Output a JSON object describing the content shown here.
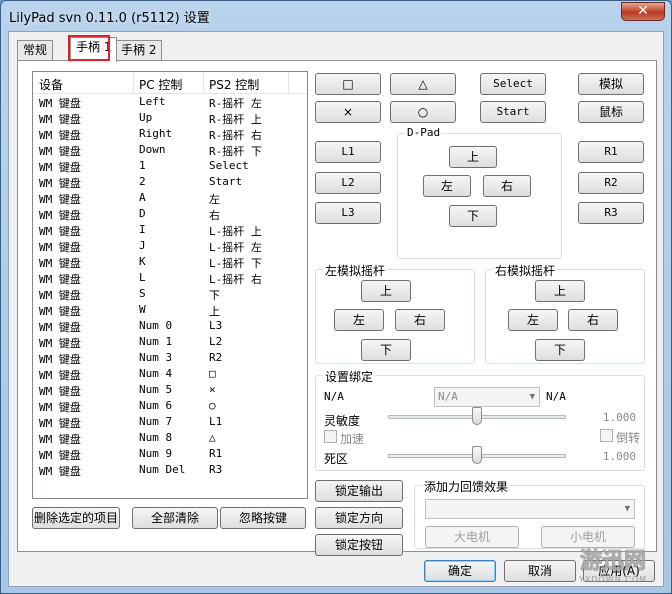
{
  "window": {
    "title": "LilyPad svn 0.11.0 (r5112) 设置",
    "close_glyph": "✕"
  },
  "tabs": [
    {
      "label": "常规"
    },
    {
      "label": "手柄 1"
    },
    {
      "label": "手柄 2"
    }
  ],
  "binding_list": {
    "columns": [
      "设备",
      "PC 控制",
      "PS2 控制"
    ],
    "rows": [
      {
        "device": "WM 键盘",
        "pc": "Left",
        "ps2": "R-摇杆 左"
      },
      {
        "device": "WM 键盘",
        "pc": "Up",
        "ps2": "R-摇杆 上"
      },
      {
        "device": "WM 键盘",
        "pc": "Right",
        "ps2": "R-摇杆 右"
      },
      {
        "device": "WM 键盘",
        "pc": "Down",
        "ps2": "R-摇杆 下"
      },
      {
        "device": "WM 键盘",
        "pc": "1",
        "ps2": "Select"
      },
      {
        "device": "WM 键盘",
        "pc": "2",
        "ps2": "Start"
      },
      {
        "device": "WM 键盘",
        "pc": "A",
        "ps2": "左"
      },
      {
        "device": "WM 键盘",
        "pc": "D",
        "ps2": "右"
      },
      {
        "device": "WM 键盘",
        "pc": "I",
        "ps2": "L-摇杆 上"
      },
      {
        "device": "WM 键盘",
        "pc": "J",
        "ps2": "L-摇杆 左"
      },
      {
        "device": "WM 键盘",
        "pc": "K",
        "ps2": "L-摇杆 下"
      },
      {
        "device": "WM 键盘",
        "pc": "L",
        "ps2": "L-摇杆 右"
      },
      {
        "device": "WM 键盘",
        "pc": "S",
        "ps2": "下"
      },
      {
        "device": "WM 键盘",
        "pc": "W",
        "ps2": "上"
      },
      {
        "device": "WM 键盘",
        "pc": "Num 0",
        "ps2": "L3"
      },
      {
        "device": "WM 键盘",
        "pc": "Num 1",
        "ps2": "L2"
      },
      {
        "device": "WM 键盘",
        "pc": "Num 3",
        "ps2": "R2"
      },
      {
        "device": "WM 键盘",
        "pc": "Num 4",
        "ps2": "□"
      },
      {
        "device": "WM 键盘",
        "pc": "Num 5",
        "ps2": "×"
      },
      {
        "device": "WM 键盘",
        "pc": "Num 6",
        "ps2": "○"
      },
      {
        "device": "WM 键盘",
        "pc": "Num 7",
        "ps2": "L1"
      },
      {
        "device": "WM 键盘",
        "pc": "Num 8",
        "ps2": "△"
      },
      {
        "device": "WM 键盘",
        "pc": "Num 9",
        "ps2": "R1"
      },
      {
        "device": "WM 键盘",
        "pc": "Num Del",
        "ps2": "R3"
      }
    ]
  },
  "list_actions": {
    "delete_selected": "删除选定的项目",
    "clear_all": "全部清除",
    "ignore_key": "忽略按键"
  },
  "face_buttons": {
    "square": "□",
    "triangle": "△",
    "select": "Select",
    "analog": "模拟",
    "cross": "×",
    "circle": "○",
    "start": "Start",
    "mouse": "鼠标"
  },
  "shoulder_buttons": {
    "l1": "L1",
    "l2": "L2",
    "l3": "L3",
    "r1": "R1",
    "r2": "R2",
    "r3": "R3"
  },
  "dpad": {
    "title": "D-Pad",
    "up": "上",
    "left": "左",
    "right": "右",
    "down": "下"
  },
  "left_stick": {
    "title": "左模拟摇杆",
    "up": "上",
    "left": "左",
    "right": "右",
    "down": "下"
  },
  "right_stick": {
    "title": "右模拟摇杆",
    "up": "上",
    "left": "左",
    "right": "右",
    "down": "下"
  },
  "binding_settings": {
    "title": "设置绑定",
    "left_value": "N/A",
    "select_value": "N/A",
    "right_value": "N/A",
    "sensitivity_label": "灵敏度",
    "sensitivity_value": "1.000",
    "sensitivity_fraction": 0.5,
    "turbo_label": "加速",
    "invert_label": "倒转",
    "deadzone_label": "死区",
    "deadzone_value": "1.000",
    "deadzone_fraction": 0.5
  },
  "lock_buttons": {
    "lock_output": "锁定输出",
    "lock_direction": "锁定方向",
    "lock_button": "锁定按钮"
  },
  "force_feedback": {
    "title": "添加力回馈效果",
    "big_motor": "大电机",
    "small_motor": "小电机"
  },
  "dialog_buttons": {
    "ok": "确定",
    "cancel": "取消",
    "apply": "应用(A)"
  },
  "watermark": {
    "text": "游迅网",
    "subtext": "YXDOWN.COM"
  },
  "colors": {
    "selected_tab_highlight": "#e0202a",
    "close_button": "#c8452f"
  }
}
